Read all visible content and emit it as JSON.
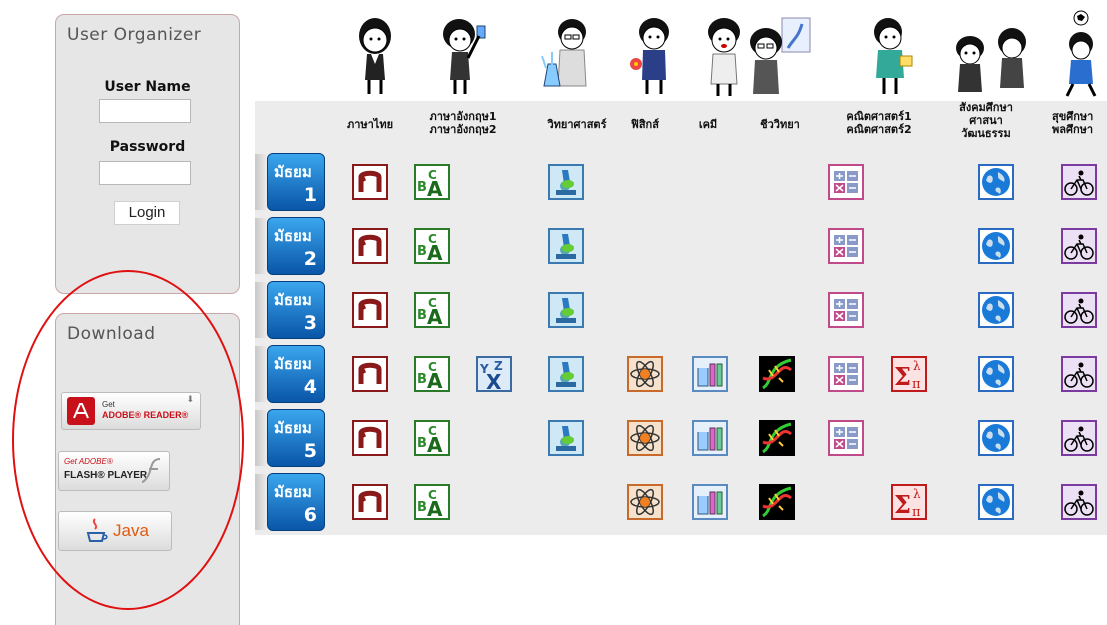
{
  "login": {
    "title": "User Organizer",
    "username_label": "User Name",
    "username_value": "",
    "password_label": "Password",
    "password_value": "",
    "button_label": "Login"
  },
  "download": {
    "title": "Download",
    "adobe_reader": {
      "small": "Get",
      "big": "ADOBE® READER®"
    },
    "flash_player": {
      "small": "Get ADOBE®",
      "big": "FLASH® PLAYER"
    },
    "java": {
      "label": "Java"
    }
  },
  "columns": [
    {
      "line1": "ภาษาไทย",
      "line2": ""
    },
    {
      "line1": "ภาษาอังกฤษ1",
      "line2": "ภาษาอังกฤษ2"
    },
    {
      "line1": "วิทยาศาสตร์",
      "line2": ""
    },
    {
      "line1": "ฟิสิกส์",
      "line2": ""
    },
    {
      "line1": "เคมี",
      "line2": ""
    },
    {
      "line1": "ชีววิทยา",
      "line2": ""
    },
    {
      "line1": "คณิตศาสตร์1",
      "line2": "คณิตศาสตร์2"
    },
    {
      "line1": "สังคมศึกษา",
      "line2": "ศาสนา",
      "line3": "วัฒนธรรม"
    },
    {
      "line1": "สุขศึกษา",
      "line2": "พลศึกษา"
    }
  ],
  "grades": [
    {
      "label": "มัธยม",
      "num": "1",
      "icons": [
        "thai-icon",
        "english-icon",
        "science-icon",
        "math-icon",
        "social-icon",
        "pe-icon"
      ]
    },
    {
      "label": "มัธยม",
      "num": "2",
      "icons": [
        "thai-icon",
        "english-icon",
        "science-icon",
        "math-icon",
        "social-icon",
        "pe-icon"
      ]
    },
    {
      "label": "มัธยม",
      "num": "3",
      "icons": [
        "thai-icon",
        "english-icon",
        "science-icon",
        "math-icon",
        "social-icon",
        "pe-icon"
      ]
    },
    {
      "label": "มัธยม",
      "num": "4",
      "icons": [
        "thai-icon",
        "english-icon",
        "english2-icon",
        "science-icon",
        "physics-icon",
        "chemistry-icon",
        "biology-icon",
        "math-icon",
        "math2-icon",
        "social-icon",
        "pe-icon"
      ]
    },
    {
      "label": "มัธยม",
      "num": "5",
      "icons": [
        "thai-icon",
        "english-icon",
        "science-icon",
        "physics-icon",
        "chemistry-icon",
        "biology-icon",
        "math-icon",
        "social-icon",
        "pe-icon"
      ]
    },
    {
      "label": "มัธยม",
      "num": "6",
      "icons": [
        "thai-icon",
        "english-icon",
        "physics-icon",
        "chemistry-icon",
        "biology-icon",
        "math2-icon",
        "social-icon",
        "pe-icon"
      ]
    }
  ],
  "colors": {
    "panel": "#e6e6e6",
    "grade_blue": "#1576c8",
    "ellipse": "#e01010"
  }
}
